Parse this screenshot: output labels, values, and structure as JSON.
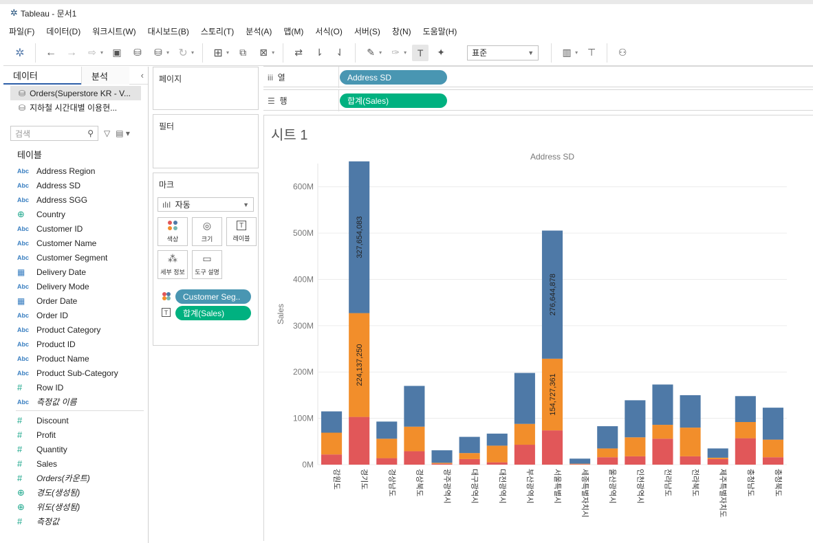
{
  "window": {
    "title": "Tableau - 문서1"
  },
  "menu": [
    "파일(F)",
    "데이터(D)",
    "워크시트(W)",
    "대시보드(B)",
    "스토리(T)",
    "분석(A)",
    "맵(M)",
    "서식(O)",
    "서버(S)",
    "창(N)",
    "도움말(H)"
  ],
  "toolbar": {
    "fit_value": "표준"
  },
  "data_pane": {
    "tab_data": "데이터",
    "tab_analytics": "분석",
    "datasources": [
      "Orders(Superstore KR - V...",
      "지하철 시간대별 이용현..."
    ],
    "search_placeholder": "검색",
    "tables_label": "테이블",
    "dimensions": [
      {
        "name": "Address Region",
        "type": "Abc"
      },
      {
        "name": "Address SD",
        "type": "Abc"
      },
      {
        "name": "Address SGG",
        "type": "Abc"
      },
      {
        "name": "Country",
        "type": "geo"
      },
      {
        "name": "Customer ID",
        "type": "Abc"
      },
      {
        "name": "Customer Name",
        "type": "Abc"
      },
      {
        "name": "Customer Segment",
        "type": "Abc"
      },
      {
        "name": "Delivery Date",
        "type": "cal"
      },
      {
        "name": "Delivery Mode",
        "type": "Abc"
      },
      {
        "name": "Order Date",
        "type": "cal"
      },
      {
        "name": "Order ID",
        "type": "Abc"
      },
      {
        "name": "Product Category",
        "type": "Abc"
      },
      {
        "name": "Product ID",
        "type": "Abc"
      },
      {
        "name": "Product Name",
        "type": "Abc"
      },
      {
        "name": "Product Sub-Category",
        "type": "Abc"
      },
      {
        "name": "Row ID",
        "type": "num"
      },
      {
        "name": "측정값 이름",
        "type": "Abc",
        "italic": true
      }
    ],
    "measures": [
      {
        "name": "Discount",
        "type": "num"
      },
      {
        "name": "Profit",
        "type": "num"
      },
      {
        "name": "Quantity",
        "type": "num"
      },
      {
        "name": "Sales",
        "type": "num"
      },
      {
        "name": "Orders(카운트)",
        "type": "num",
        "italic": true
      },
      {
        "name": "경도(생성됨)",
        "type": "geo",
        "italic": true
      },
      {
        "name": "위도(생성됨)",
        "type": "geo",
        "italic": true
      },
      {
        "name": "측정값",
        "type": "num",
        "italic": true
      }
    ]
  },
  "cards": {
    "pages": "페이지",
    "filters": "필터",
    "marks": "마크",
    "mark_type": "자동",
    "mark_buttons": [
      "색상",
      "크기",
      "레이블",
      "세부 정보",
      "도구 설명"
    ],
    "mark_pills": [
      "Customer Seg..",
      "합계(Sales)"
    ]
  },
  "shelves": {
    "columns_label": "열",
    "rows_label": "행",
    "columns_pill": "Address SD",
    "rows_pill": "합계(Sales)"
  },
  "sheet": {
    "title": "시트 1"
  },
  "colors": {
    "segment_a": "#4e79a7",
    "segment_b": "#f28e2b",
    "segment_c": "#e15759",
    "pill_blue": "#4996b2",
    "pill_green": "#00b180"
  },
  "chart_data": {
    "type": "bar",
    "stacked": true,
    "title": "Address SD",
    "xlabel": "",
    "ylabel": "Sales",
    "ylim": [
      0,
      650000000
    ],
    "yticks": [
      0,
      100000000,
      200000000,
      300000000,
      400000000,
      500000000,
      600000000
    ],
    "ytick_labels": [
      "0M",
      "100M",
      "200M",
      "300M",
      "400M",
      "500M",
      "600M"
    ],
    "grid": true,
    "categories": [
      "강원도",
      "경기도",
      "경상남도",
      "경상북도",
      "광주광역시",
      "대구광역시",
      "대전광역시",
      "부산광역시",
      "서울특별시",
      "세종특별자치시",
      "울산광역시",
      "인천광역시",
      "전라남도",
      "전라북도",
      "제주특별자치도",
      "충청남도",
      "충청북도"
    ],
    "series": [
      {
        "values": [
          22000000,
          103000000,
          14000000,
          29000000,
          2000000,
          12000000,
          5000000,
          43000000,
          74000000,
          1000000,
          16000000,
          18000000,
          56000000,
          18000000,
          12000000,
          57000000,
          16000000
        ]
      },
      {
        "values": [
          47000000,
          224137250,
          42000000,
          53000000,
          2000000,
          13000000,
          36000000,
          45000000,
          154727361,
          1000000,
          19000000,
          41000000,
          30000000,
          62000000,
          3000000,
          35000000,
          38000000
        ]
      },
      {
        "values": [
          46000000,
          327654083,
          37000000,
          88000000,
          27000000,
          35000000,
          26000000,
          110000000,
          276644878,
          11000000,
          48000000,
          80000000,
          87000000,
          70000000,
          20000000,
          56000000,
          69000000
        ]
      }
    ],
    "data_labels": [
      {
        "category": "경기도",
        "series": 1,
        "text": "224,137,250"
      },
      {
        "category": "경기도",
        "series": 2,
        "text": "327,654,083"
      },
      {
        "category": "서울특별시",
        "series": 1,
        "text": "154,727,361"
      },
      {
        "category": "서울특별시",
        "series": 2,
        "text": "276,644,878"
      }
    ]
  }
}
